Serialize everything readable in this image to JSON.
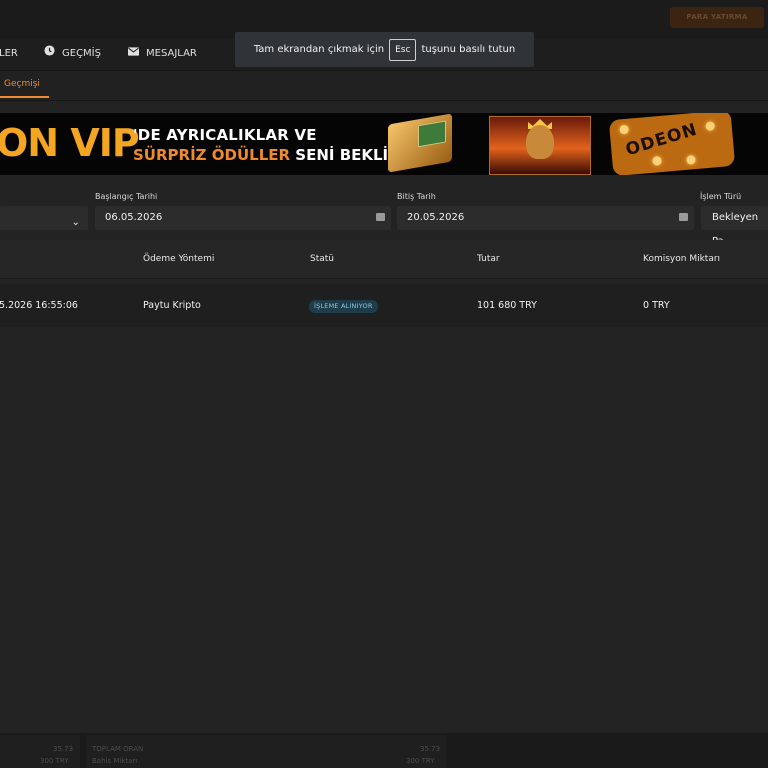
{
  "topbar": {
    "deposit_label": "PARA YATIRMA"
  },
  "nav": {
    "items": [
      {
        "label": "LER"
      },
      {
        "label": "GEÇMİŞ",
        "icon": "clock-icon"
      },
      {
        "label": "MESAJLAR",
        "icon": "envelope-icon"
      }
    ]
  },
  "subnav": {
    "active_tab": "Geçmişi"
  },
  "fullscreen_notice": {
    "before": "Tam ekrandan çıkmak için",
    "key": "Esc",
    "after": "tuşunu basılı tutun"
  },
  "banner": {
    "vip_text": "ON VIP",
    "line1": "'DE AYRICALIKLAR VE",
    "line2_highlight": "SÜRPRİZ ÖDÜLLER",
    "line2_rest": " SENİ BEKLİYOR!",
    "dice_logo": "ODEON"
  },
  "filters": {
    "start_label": "Başlangıç Tarihi",
    "start_value": "06.05.2026",
    "end_label": "Bitiş Tarih",
    "end_value": "20.05.2026",
    "type_label": "İşlem Türü",
    "type_value": "Bekleyen Pa"
  },
  "table": {
    "headers": {
      "method": "Ödeme Yöntemi",
      "status": "Statü",
      "amount": "Tutar",
      "commission": "Komisyon Miktarı"
    },
    "rows": [
      {
        "date": "5.2026 16:55:06",
        "method": "Paytu Kripto",
        "status": "İŞLEME ALINIYOR",
        "amount": "101 680 TRY",
        "commission": "0 TRY"
      }
    ]
  },
  "footer": {
    "left_value": "35.73",
    "left_amount": "300 TRY",
    "mid_label": "TOPLAM ORAN",
    "mid_sub": "Bahis Miktarı",
    "mid_value": "35.73",
    "mid_amount": "300 TRY"
  },
  "colors": {
    "accent": "#f08b2c",
    "background": "#232323",
    "badge": "#1f3c4a"
  }
}
